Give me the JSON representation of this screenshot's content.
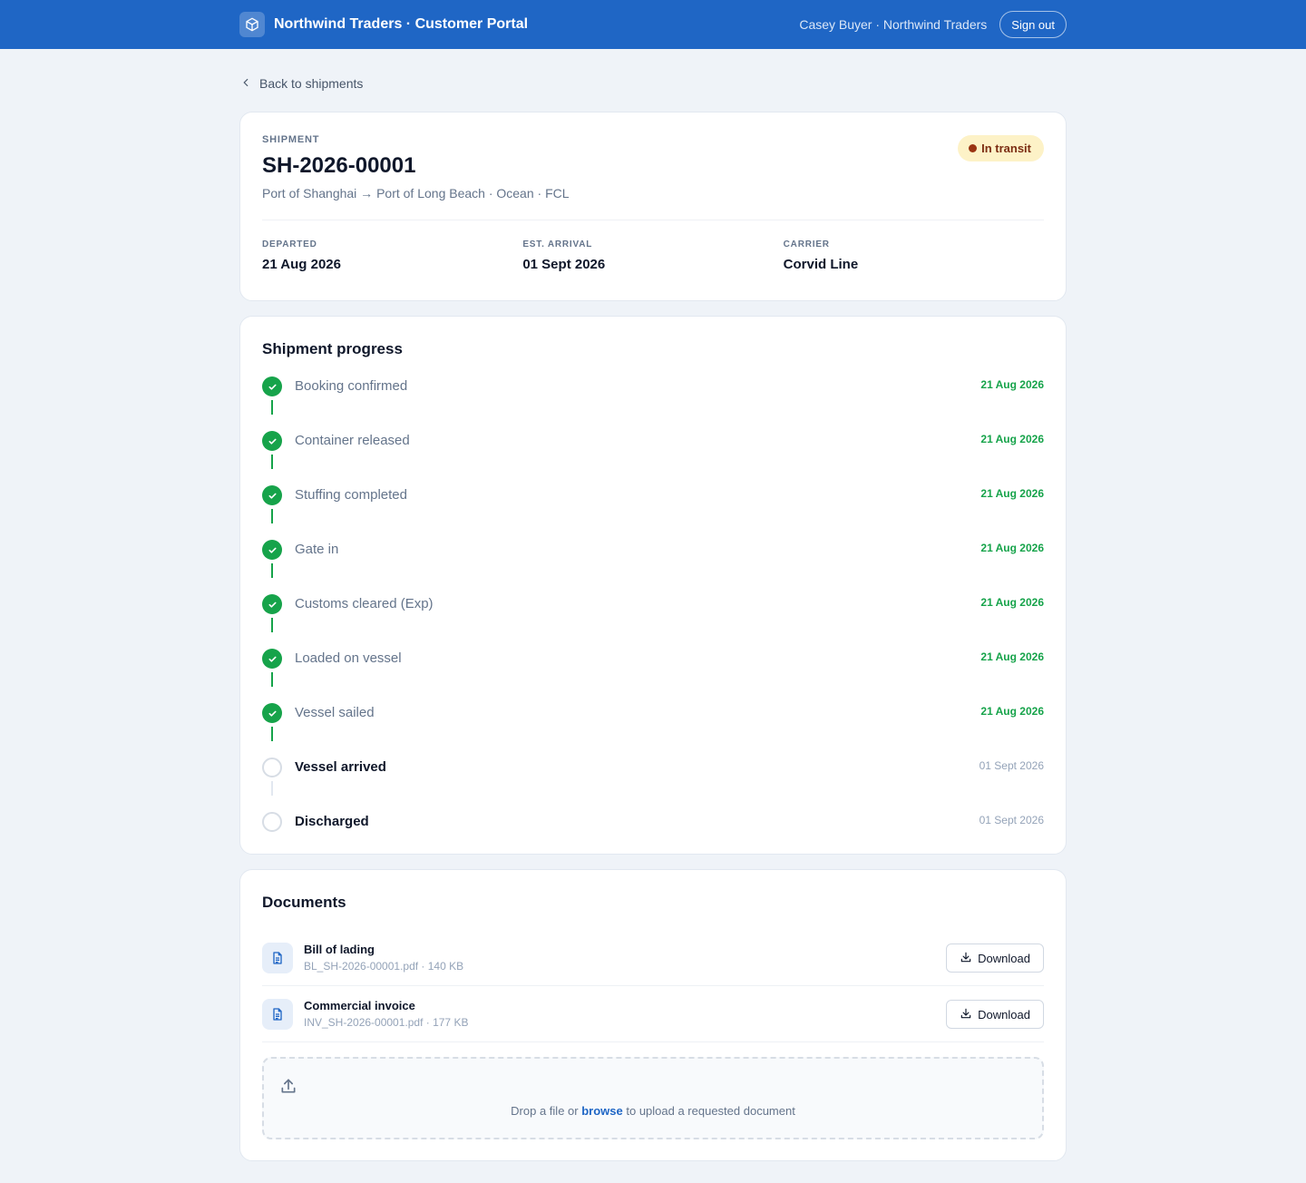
{
  "header": {
    "title": "Northwind Traders · Customer Portal",
    "user": "Casey Buyer · Northwind Traders",
    "signout_label": "Sign out"
  },
  "nav": {
    "back_label": "Back to shipments"
  },
  "shipment": {
    "eyebrow": "SHIPMENT",
    "id": "SH-2026-00001",
    "route": "Port of Shanghai → Port of Long Beach · Ocean · FCL",
    "status": "In transit",
    "meta": [
      {
        "label": "DEPARTED",
        "value": "21 Aug 2026"
      },
      {
        "label": "EST. ARRIVAL",
        "value": "01 Sept 2026"
      },
      {
        "label": "CARRIER",
        "value": "Corvid Line"
      }
    ]
  },
  "progress": {
    "title": "Shipment progress",
    "steps": [
      {
        "label": "Booking confirmed",
        "date": "21 Aug 2026"
      },
      {
        "label": "Container released",
        "date": "21 Aug 2026"
      },
      {
        "label": "Stuffing completed",
        "date": "21 Aug 2026"
      },
      {
        "label": "Gate in",
        "date": "21 Aug 2026"
      },
      {
        "label": "Customs cleared (Exp)",
        "date": "21 Aug 2026"
      },
      {
        "label": "Loaded on vessel",
        "date": "21 Aug 2026"
      },
      {
        "label": "Vessel sailed",
        "date": "21 Aug 2026"
      },
      {
        "label": "Vessel arrived",
        "date": "01 Sept 2026"
      },
      {
        "label": "Discharged",
        "date": "01 Sept 2026"
      }
    ]
  },
  "documents": {
    "title": "Documents",
    "items": [
      {
        "name": "Bill of lading",
        "meta": "BL_SH-2026-00001.pdf · 140 KB",
        "action": "Download"
      },
      {
        "name": "Commercial invoice",
        "meta": "INV_SH-2026-00001.pdf · 177 KB",
        "action": "Download"
      }
    ],
    "upload": {
      "prefix": "Drop a file or",
      "link": "browse",
      "suffix": "to upload a requested document"
    }
  },
  "colors": {
    "header_bg": "#1f66c5",
    "done": "#16a34a",
    "badge_bg": "#fdf2c7",
    "badge_text": "#7c2d12"
  }
}
